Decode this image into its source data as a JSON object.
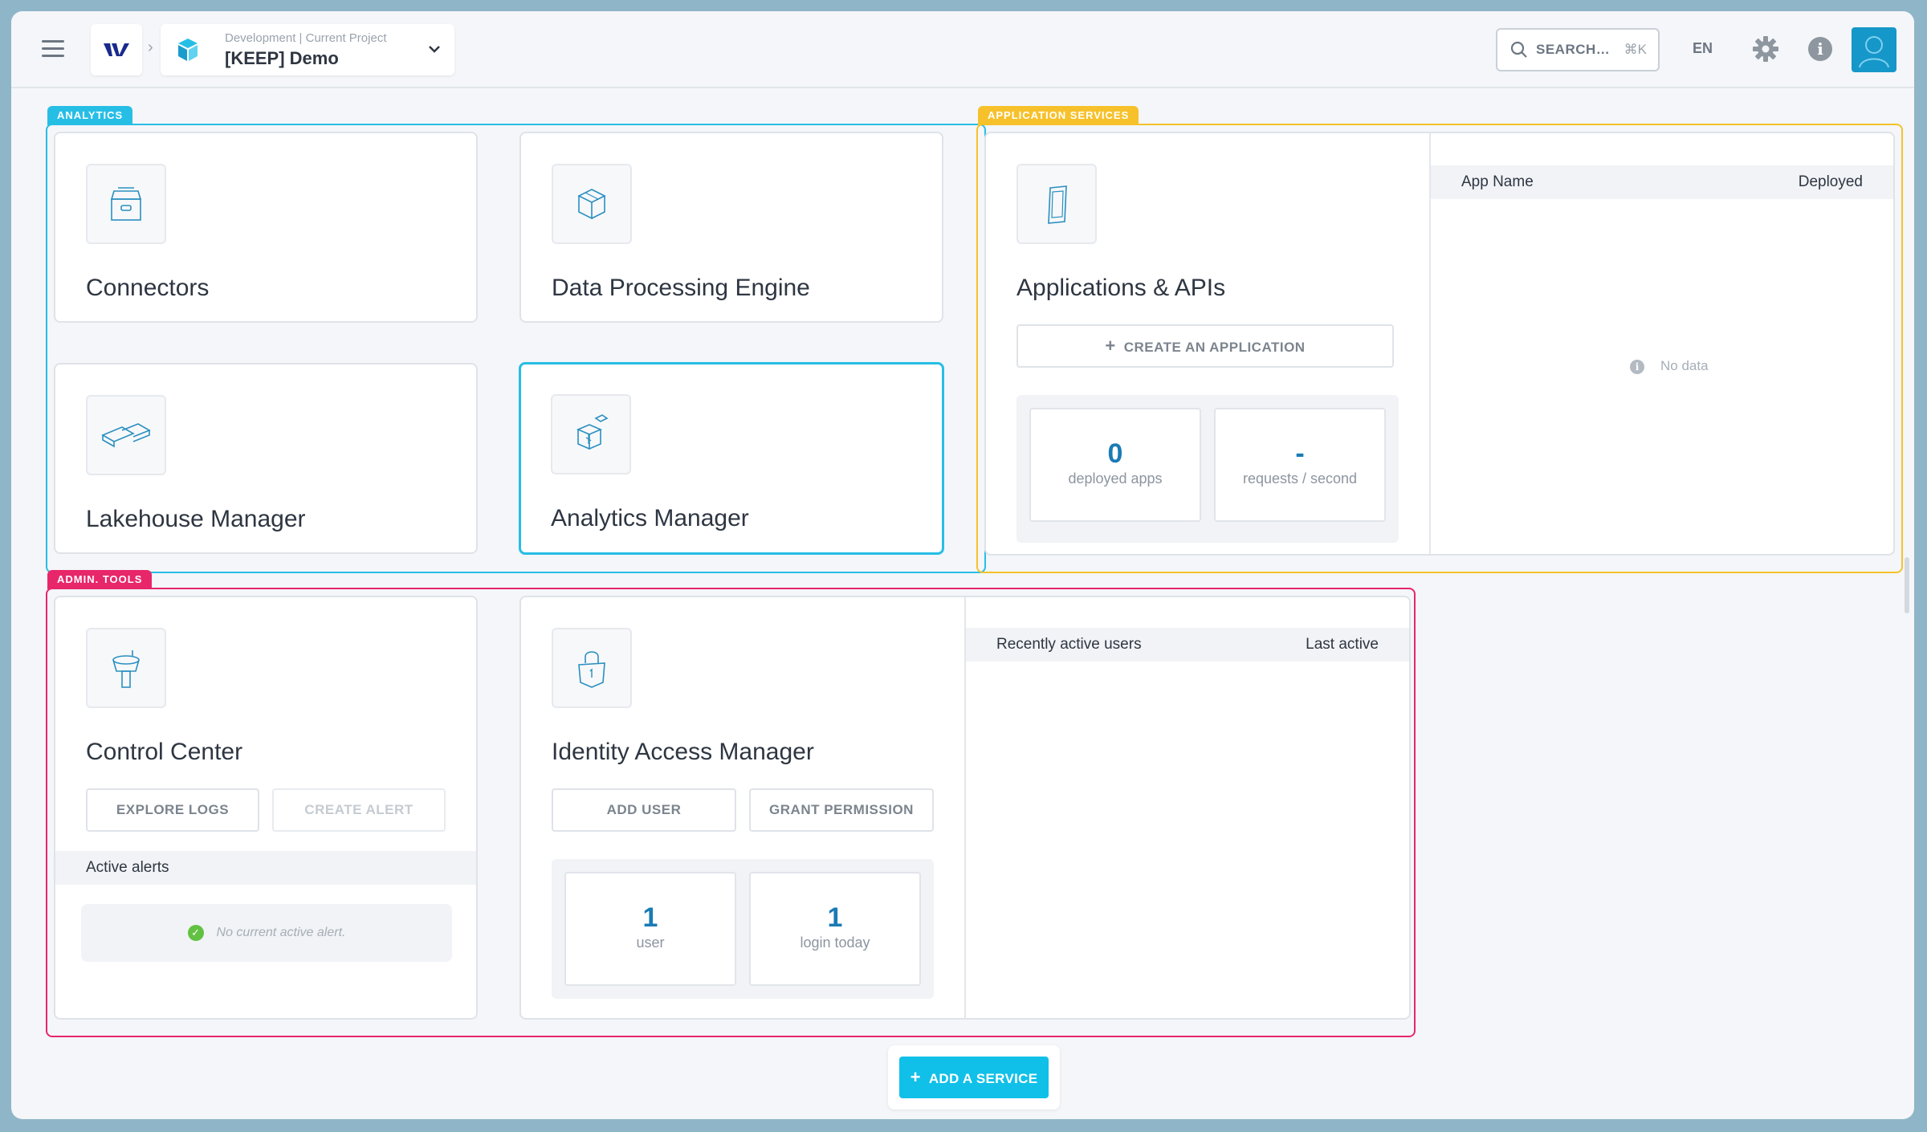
{
  "topbar": {
    "project_meta": "Development  |  Current Project",
    "project_name": "[KEEP] Demo",
    "search_label": "SEARCH…",
    "search_shortcut": "⌘K",
    "language": "EN"
  },
  "analytics": {
    "tag": "ANALYTICS",
    "cards": [
      {
        "title": "Connectors",
        "icon": "storage-box-icon"
      },
      {
        "title": "Data Processing Engine",
        "icon": "cube-icon"
      },
      {
        "title": "Lakehouse Manager",
        "icon": "warehouse-icon"
      },
      {
        "title": "Analytics Manager",
        "icon": "analytics-cube-icon"
      }
    ]
  },
  "app_services": {
    "tag": "APPLICATION SERVICES",
    "title": "Applications & APIs",
    "create_button": "CREATE AN APPLICATION",
    "stats": [
      {
        "value": "0",
        "label": "deployed apps"
      },
      {
        "value": "-",
        "label": "requests / second"
      }
    ],
    "table": {
      "col1": "App Name",
      "col2": "Deployed",
      "empty": "No data"
    }
  },
  "admin_tools": {
    "tag": "ADMIN. TOOLS",
    "control_center": {
      "title": "Control Center",
      "explore_button": "EXPLORE LOGS",
      "alert_button": "CREATE ALERT",
      "alerts_header": "Active alerts",
      "no_alert": "No current active alert."
    },
    "iam": {
      "title": "Identity Access Manager",
      "add_user_button": "ADD USER",
      "grant_button": "GRANT PERMISSION",
      "stats": [
        {
          "value": "1",
          "label": "user"
        },
        {
          "value": "1",
          "label": "login today"
        }
      ],
      "table": {
        "col1": "Recently active users",
        "col2": "Last active"
      }
    }
  },
  "add_service_button": "ADD A SERVICE",
  "colors": {
    "analytics": "#27bee6",
    "app_services": "#f6c12b",
    "admin_tools": "#e8266a",
    "stat_value": "#1a7bb5",
    "primary_button": "#10c0e8"
  }
}
